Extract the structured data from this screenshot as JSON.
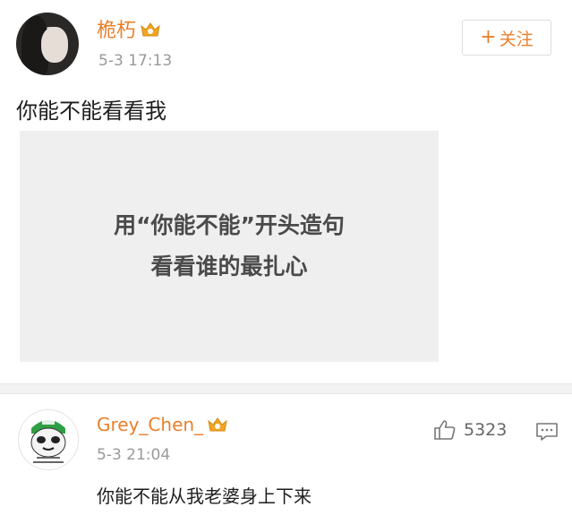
{
  "post": {
    "username": "桅朽",
    "timestamp": "5-3 17:13",
    "follow_label": "关注",
    "text": "你能不能看看我",
    "image": {
      "line1": "用“你能不能”开头造句",
      "line2": "看看谁的最扎心"
    }
  },
  "comment": {
    "username": "Grey_Chen_",
    "timestamp": "5-3 21:04",
    "text": "你能不能从我老婆身上下来",
    "like_count": "5323"
  },
  "icons": {
    "vip": "vip-badge-icon",
    "like": "thumbs-up-icon",
    "comment": "comment-icon",
    "plus": "plus-icon"
  },
  "colors": {
    "accent": "#e8802c",
    "meta": "#999999"
  }
}
